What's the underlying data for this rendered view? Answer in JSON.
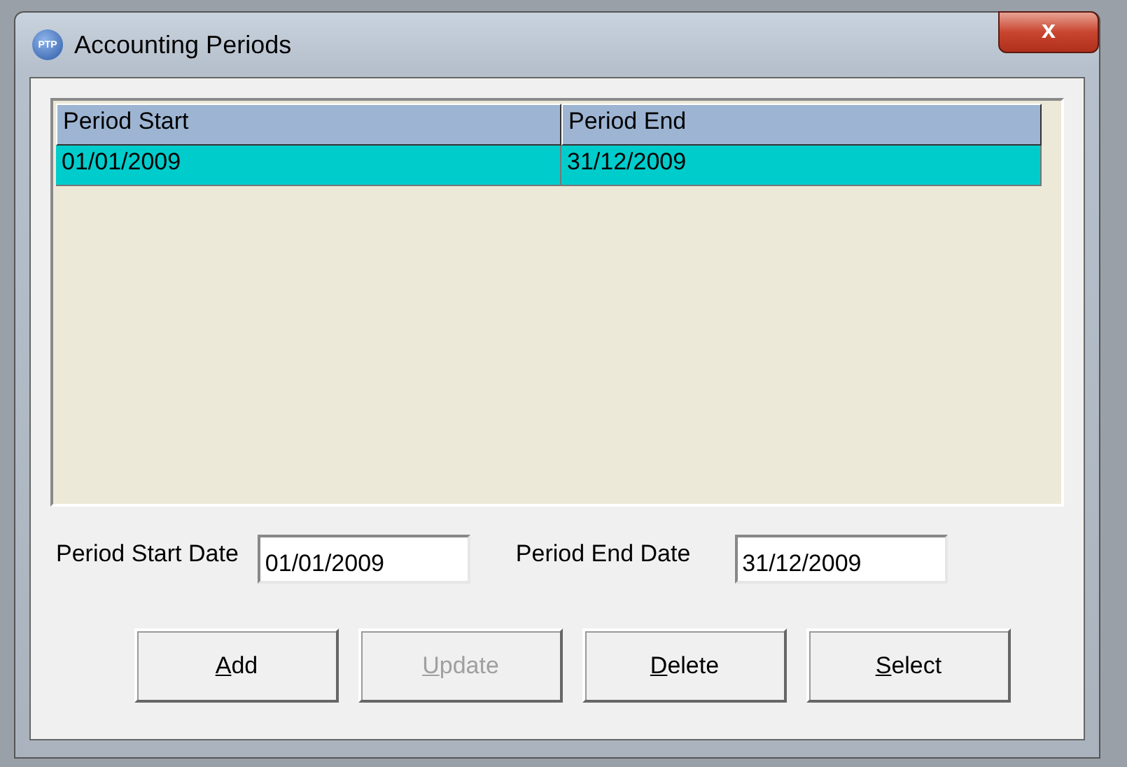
{
  "window": {
    "title": "Accounting Periods",
    "icon_text": "PTP",
    "close_label": "x"
  },
  "table": {
    "columns": [
      "Period Start",
      "Period End"
    ],
    "rows": [
      {
        "cells": [
          "01/01/2009",
          "31/12/2009"
        ],
        "selected": true
      }
    ]
  },
  "fields": [
    {
      "label": "Period Start Date",
      "value": "01/01/2009"
    },
    {
      "label": "Period End Date",
      "value": "31/12/2009"
    }
  ],
  "buttons": [
    {
      "mnemonic": "A",
      "rest": "dd",
      "disabled": false
    },
    {
      "mnemonic": "U",
      "rest": "pdate",
      "disabled": true
    },
    {
      "mnemonic": "D",
      "rest": "elete",
      "disabled": false
    },
    {
      "mnemonic": "S",
      "rest": "elect",
      "disabled": false
    }
  ]
}
